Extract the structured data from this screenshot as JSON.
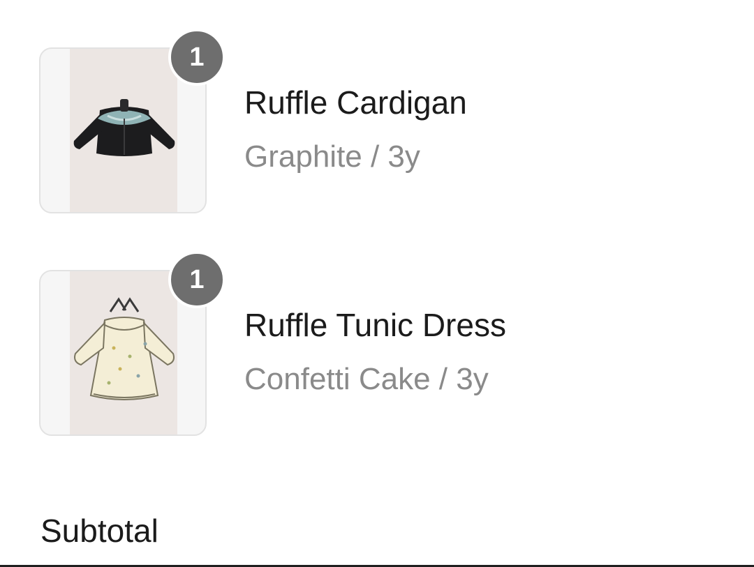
{
  "cart": {
    "items": [
      {
        "name": "Ruffle Cardigan",
        "variant": "Graphite / 3y",
        "quantity": "1",
        "thumbnail_icon": "cardigan-icon"
      },
      {
        "name": "Ruffle Tunic Dress",
        "variant": "Confetti Cake / 3y",
        "quantity": "1",
        "thumbnail_icon": "tunic-dress-icon"
      }
    ]
  },
  "summary": {
    "subtotal_label": "Subtotal"
  },
  "colors": {
    "badge": "#6e6e6e",
    "variant_text": "#8a8a8a",
    "product_photo_bg": "#ece6e3"
  }
}
